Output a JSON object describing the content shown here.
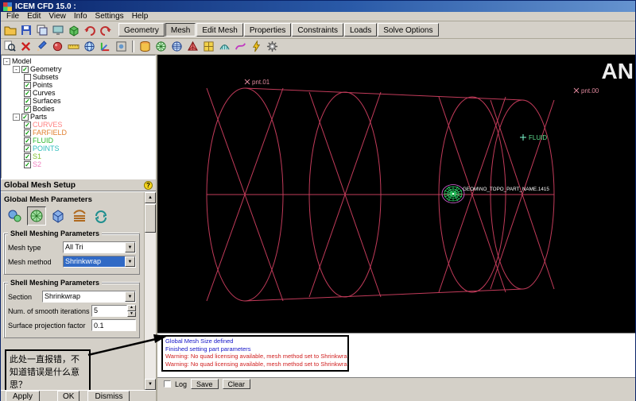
{
  "window": {
    "title": "ICEM CFD 15.0 :"
  },
  "menubar": {
    "items": [
      "File",
      "Edit",
      "View",
      "Info",
      "Settings",
      "Help"
    ]
  },
  "toolbar": {
    "tabs": [
      "Geometry",
      "Mesh",
      "Edit Mesh",
      "Properties",
      "Constraints",
      "Loads",
      "Solve Options"
    ],
    "active_tab": "Mesh"
  },
  "tree": {
    "root": "Model",
    "geometry": {
      "label": "Geometry",
      "items": [
        {
          "label": "Subsets",
          "checked": false
        },
        {
          "label": "Points",
          "checked": true
        },
        {
          "label": "Curves",
          "checked": true
        },
        {
          "label": "Surfaces",
          "checked": true
        },
        {
          "label": "Bodies",
          "checked": true
        }
      ]
    },
    "parts": {
      "label": "Parts",
      "items": [
        {
          "label": "CURVES",
          "color": "#ff8080"
        },
        {
          "label": "FARFIELD",
          "color": "#e07f2e"
        },
        {
          "label": "FLUID",
          "color": "#2eb82e"
        },
        {
          "label": "POINTS",
          "color": "#2ebdbd"
        },
        {
          "label": "S1",
          "color": "#7fc02e"
        },
        {
          "label": "S2",
          "color": "#f07fc0"
        }
      ]
    }
  },
  "panel": {
    "title": "Global Mesh Setup",
    "params_title": "Global Mesh Parameters",
    "shell1": {
      "title": "Shell Meshing Parameters",
      "mesh_type_label": "Mesh type",
      "mesh_type_value": "All Tri",
      "mesh_method_label": "Mesh method",
      "mesh_method_value": "Shrinkwrap"
    },
    "shell2": {
      "title": "Shell Meshing Parameters",
      "section_label": "Section",
      "section_value": "Shrinkwrap",
      "smooth_label": "Num. of smooth iterations",
      "smooth_value": "5",
      "projection_label": "Surface projection factor",
      "projection_value": "0.1"
    },
    "buttons": {
      "apply": "Apply",
      "ok": "OK",
      "dismiss": "Dismiss"
    }
  },
  "annotation": {
    "text": "此处一直报错，不知道错误是什么意思？"
  },
  "viewport": {
    "wireframe_color": "#c23b5a",
    "mesh_color": "#2ee06e",
    "labels": {
      "pnt01": "pnt.01",
      "pnt00": "pnt.00",
      "fluid": "FLUID",
      "mesh_part": "GEOM\\NO_TOPO_PART_NAME.1415",
      "logo": "AN"
    }
  },
  "messages": {
    "lines": [
      {
        "text": "Global Mesh Size defined",
        "color": "#1414c8"
      },
      {
        "text": "Finished setting part parameters",
        "color": "#1414c8"
      },
      {
        "text": "Warning: No quad licensing available, mesh method set to Shrinkwrap",
        "color": "#d02020"
      },
      {
        "text": "Warning: No quad licensing available, mesh method set to Shrinkwrap",
        "color": "#d02020"
      }
    ]
  },
  "logbar": {
    "log_label": "Log",
    "save": "Save",
    "clear": "Clear"
  }
}
